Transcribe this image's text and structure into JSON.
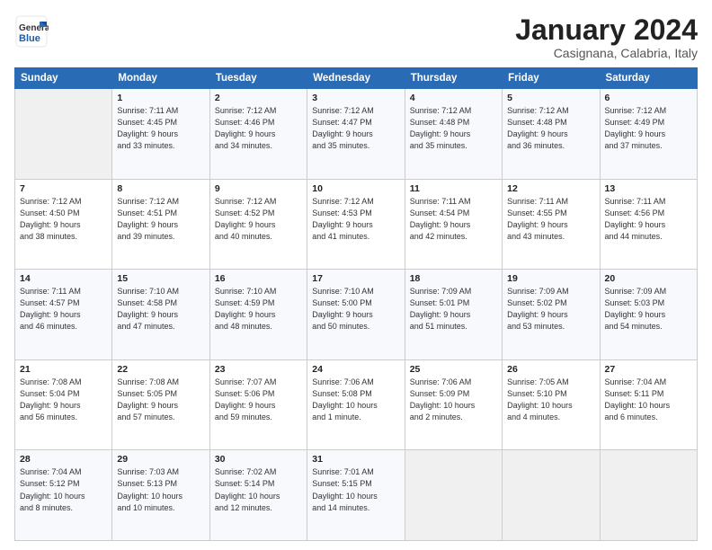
{
  "header": {
    "logo_line1": "General",
    "logo_line2": "Blue",
    "title": "January 2024",
    "subtitle": "Casignana, Calabria, Italy"
  },
  "weekdays": [
    "Sunday",
    "Monday",
    "Tuesday",
    "Wednesday",
    "Thursday",
    "Friday",
    "Saturday"
  ],
  "weeks": [
    [
      {
        "day": "",
        "info": ""
      },
      {
        "day": "1",
        "info": "Sunrise: 7:11 AM\nSunset: 4:45 PM\nDaylight: 9 hours\nand 33 minutes."
      },
      {
        "day": "2",
        "info": "Sunrise: 7:12 AM\nSunset: 4:46 PM\nDaylight: 9 hours\nand 34 minutes."
      },
      {
        "day": "3",
        "info": "Sunrise: 7:12 AM\nSunset: 4:47 PM\nDaylight: 9 hours\nand 35 minutes."
      },
      {
        "day": "4",
        "info": "Sunrise: 7:12 AM\nSunset: 4:48 PM\nDaylight: 9 hours\nand 35 minutes."
      },
      {
        "day": "5",
        "info": "Sunrise: 7:12 AM\nSunset: 4:48 PM\nDaylight: 9 hours\nand 36 minutes."
      },
      {
        "day": "6",
        "info": "Sunrise: 7:12 AM\nSunset: 4:49 PM\nDaylight: 9 hours\nand 37 minutes."
      }
    ],
    [
      {
        "day": "7",
        "info": "Sunrise: 7:12 AM\nSunset: 4:50 PM\nDaylight: 9 hours\nand 38 minutes."
      },
      {
        "day": "8",
        "info": "Sunrise: 7:12 AM\nSunset: 4:51 PM\nDaylight: 9 hours\nand 39 minutes."
      },
      {
        "day": "9",
        "info": "Sunrise: 7:12 AM\nSunset: 4:52 PM\nDaylight: 9 hours\nand 40 minutes."
      },
      {
        "day": "10",
        "info": "Sunrise: 7:12 AM\nSunset: 4:53 PM\nDaylight: 9 hours\nand 41 minutes."
      },
      {
        "day": "11",
        "info": "Sunrise: 7:11 AM\nSunset: 4:54 PM\nDaylight: 9 hours\nand 42 minutes."
      },
      {
        "day": "12",
        "info": "Sunrise: 7:11 AM\nSunset: 4:55 PM\nDaylight: 9 hours\nand 43 minutes."
      },
      {
        "day": "13",
        "info": "Sunrise: 7:11 AM\nSunset: 4:56 PM\nDaylight: 9 hours\nand 44 minutes."
      }
    ],
    [
      {
        "day": "14",
        "info": "Sunrise: 7:11 AM\nSunset: 4:57 PM\nDaylight: 9 hours\nand 46 minutes."
      },
      {
        "day": "15",
        "info": "Sunrise: 7:10 AM\nSunset: 4:58 PM\nDaylight: 9 hours\nand 47 minutes."
      },
      {
        "day": "16",
        "info": "Sunrise: 7:10 AM\nSunset: 4:59 PM\nDaylight: 9 hours\nand 48 minutes."
      },
      {
        "day": "17",
        "info": "Sunrise: 7:10 AM\nSunset: 5:00 PM\nDaylight: 9 hours\nand 50 minutes."
      },
      {
        "day": "18",
        "info": "Sunrise: 7:09 AM\nSunset: 5:01 PM\nDaylight: 9 hours\nand 51 minutes."
      },
      {
        "day": "19",
        "info": "Sunrise: 7:09 AM\nSunset: 5:02 PM\nDaylight: 9 hours\nand 53 minutes."
      },
      {
        "day": "20",
        "info": "Sunrise: 7:09 AM\nSunset: 5:03 PM\nDaylight: 9 hours\nand 54 minutes."
      }
    ],
    [
      {
        "day": "21",
        "info": "Sunrise: 7:08 AM\nSunset: 5:04 PM\nDaylight: 9 hours\nand 56 minutes."
      },
      {
        "day": "22",
        "info": "Sunrise: 7:08 AM\nSunset: 5:05 PM\nDaylight: 9 hours\nand 57 minutes."
      },
      {
        "day": "23",
        "info": "Sunrise: 7:07 AM\nSunset: 5:06 PM\nDaylight: 9 hours\nand 59 minutes."
      },
      {
        "day": "24",
        "info": "Sunrise: 7:06 AM\nSunset: 5:08 PM\nDaylight: 10 hours\nand 1 minute."
      },
      {
        "day": "25",
        "info": "Sunrise: 7:06 AM\nSunset: 5:09 PM\nDaylight: 10 hours\nand 2 minutes."
      },
      {
        "day": "26",
        "info": "Sunrise: 7:05 AM\nSunset: 5:10 PM\nDaylight: 10 hours\nand 4 minutes."
      },
      {
        "day": "27",
        "info": "Sunrise: 7:04 AM\nSunset: 5:11 PM\nDaylight: 10 hours\nand 6 minutes."
      }
    ],
    [
      {
        "day": "28",
        "info": "Sunrise: 7:04 AM\nSunset: 5:12 PM\nDaylight: 10 hours\nand 8 minutes."
      },
      {
        "day": "29",
        "info": "Sunrise: 7:03 AM\nSunset: 5:13 PM\nDaylight: 10 hours\nand 10 minutes."
      },
      {
        "day": "30",
        "info": "Sunrise: 7:02 AM\nSunset: 5:14 PM\nDaylight: 10 hours\nand 12 minutes."
      },
      {
        "day": "31",
        "info": "Sunrise: 7:01 AM\nSunset: 5:15 PM\nDaylight: 10 hours\nand 14 minutes."
      },
      {
        "day": "",
        "info": ""
      },
      {
        "day": "",
        "info": ""
      },
      {
        "day": "",
        "info": ""
      }
    ]
  ]
}
